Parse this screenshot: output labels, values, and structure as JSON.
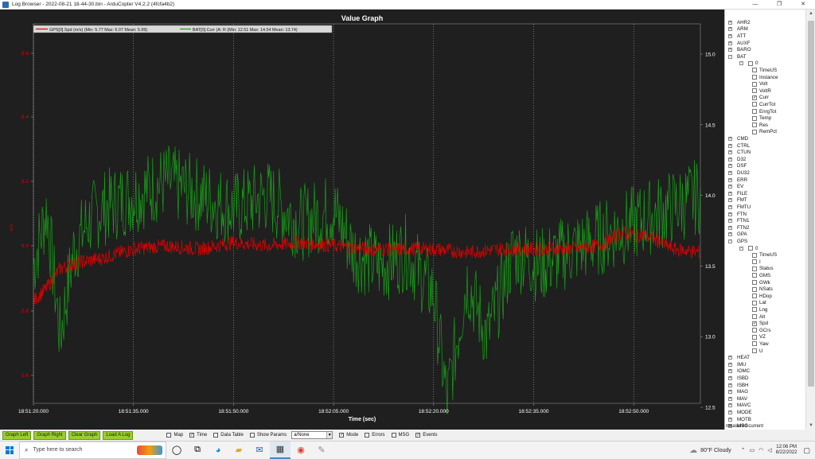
{
  "window": {
    "title": "Log Browser - 2022-08-21 18-44-30.bin - ArduCopter V4.2.2 (4fcfa4b2)",
    "controls": [
      "—",
      "❐",
      "✕"
    ]
  },
  "graph": {
    "title": "Value Graph",
    "xlabel": "Time (sec)",
    "legend": [
      {
        "label": "GPS[0].Spd (m/s)  (Min: 5.77 Max: 6.07 Mean: 5.99)",
        "color": "#e00000"
      },
      {
        "label": "BAT[0].Curr (A: R  (Min: 12.51 Max: 14.54 Mean: 13.74)",
        "color": "#16a016"
      }
    ],
    "left_ticks": [
      "6.8",
      "6.4",
      "6.2",
      "6.0",
      "5.8",
      "5.6"
    ],
    "left_unit": "m/s",
    "right_ticks": [
      "15.0",
      "14.5",
      "14.0",
      "13.5",
      "13.0",
      "12.5"
    ],
    "x_ticks": [
      "18:51:20.000",
      "18:51:35.000",
      "18:51:50.000",
      "18:52:05.000",
      "18:52:20.000",
      "18:52:35.000",
      "18:52:50.000"
    ]
  },
  "chart_data": {
    "type": "line",
    "title": "Value Graph",
    "xlabel": "Time (sec)",
    "ylabel_left": "m/s",
    "x_range": [
      "18:51:20",
      "18:53:00"
    ],
    "y_left_ticks": [
      6.8,
      6.4,
      6.2,
      6.0,
      5.8,
      5.6
    ],
    "y_right_range": [
      12.5,
      15.0
    ],
    "grid": true,
    "legend_position": "top-left",
    "series": [
      {
        "name": "GPS[0].Spd (m/s)",
        "color": "#e00000",
        "axis": "left",
        "x": [
          "18:51:20",
          "18:51:22",
          "18:51:24",
          "18:51:27",
          "18:51:30",
          "18:51:35",
          "18:51:40",
          "18:51:45",
          "18:51:50",
          "18:51:55",
          "18:52:00",
          "18:52:05",
          "18:52:10",
          "18:52:15",
          "18:52:20",
          "18:52:25",
          "18:52:30",
          "18:52:35",
          "18:52:40",
          "18:52:45",
          "18:52:48",
          "18:52:52",
          "18:52:56",
          "18:53:00"
        ],
        "values": [
          5.83,
          5.87,
          5.93,
          5.95,
          5.96,
          5.99,
          6.0,
          5.99,
          6.01,
          6.0,
          6.01,
          6.0,
          5.99,
          5.99,
          5.99,
          5.98,
          5.99,
          5.99,
          5.99,
          6.0,
          6.04,
          6.03,
          5.99,
          5.98
        ]
      },
      {
        "name": "BAT[0].Curr (A: R",
        "color": "#16a016",
        "axis": "right",
        "x": [
          "18:51:20",
          "18:51:22",
          "18:51:24",
          "18:51:26",
          "18:51:28",
          "18:51:30",
          "18:51:35",
          "18:51:40",
          "18:51:45",
          "18:51:50",
          "18:51:55",
          "18:52:00",
          "18:52:05",
          "18:52:08",
          "18:52:12",
          "18:52:16",
          "18:52:20",
          "18:52:22",
          "18:52:25",
          "18:52:28",
          "18:52:32",
          "18:52:36",
          "18:52:40",
          "18:52:45",
          "18:52:50",
          "18:52:55",
          "18:53:00"
        ],
        "values": [
          13.5,
          13.9,
          13.0,
          13.6,
          13.8,
          13.9,
          14.0,
          14.1,
          14.0,
          13.9,
          14.0,
          13.8,
          13.9,
          13.6,
          13.5,
          13.6,
          13.3,
          12.55,
          13.4,
          13.0,
          13.6,
          13.5,
          13.6,
          13.7,
          13.8,
          13.9,
          14.0
        ]
      }
    ]
  },
  "tree": {
    "items": [
      {
        "label": "AHR2",
        "level": 0,
        "exp": "+"
      },
      {
        "label": "ARM",
        "level": 0,
        "exp": "+"
      },
      {
        "label": "ATT",
        "level": 0,
        "exp": "+"
      },
      {
        "label": "AUXF",
        "level": 0,
        "exp": "+"
      },
      {
        "label": "BARO",
        "level": 0,
        "exp": "+"
      },
      {
        "label": "BAT",
        "level": 0,
        "exp": "−"
      },
      {
        "label": "0",
        "level": 1,
        "exp": "−",
        "cb": ""
      },
      {
        "label": "TimeUS",
        "level": 2,
        "cb": ""
      },
      {
        "label": "Instance",
        "level": 2,
        "cb": ""
      },
      {
        "label": "Volt",
        "level": 2,
        "cb": ""
      },
      {
        "label": "VoltR",
        "level": 2,
        "cb": ""
      },
      {
        "label": "Curr",
        "level": 2,
        "cb": "✓"
      },
      {
        "label": "CurrTot",
        "level": 2,
        "cb": ""
      },
      {
        "label": "EnrgTot",
        "level": 2,
        "cb": ""
      },
      {
        "label": "Temp",
        "level": 2,
        "cb": ""
      },
      {
        "label": "Res",
        "level": 2,
        "cb": ""
      },
      {
        "label": "RemPct",
        "level": 2,
        "cb": ""
      },
      {
        "label": "CMD",
        "level": 0,
        "exp": "+"
      },
      {
        "label": "CTRL",
        "level": 0,
        "exp": "+"
      },
      {
        "label": "CTUN",
        "level": 0,
        "exp": "+"
      },
      {
        "label": "D32",
        "level": 0,
        "exp": "+"
      },
      {
        "label": "DSF",
        "level": 0,
        "exp": "+"
      },
      {
        "label": "DU32",
        "level": 0,
        "exp": "+"
      },
      {
        "label": "ERR",
        "level": 0,
        "exp": "+"
      },
      {
        "label": "EV",
        "level": 0,
        "exp": "+"
      },
      {
        "label": "FILE",
        "level": 0,
        "exp": "+"
      },
      {
        "label": "FMT",
        "level": 0,
        "exp": "+"
      },
      {
        "label": "FMTU",
        "level": 0,
        "exp": "+"
      },
      {
        "label": "FTN",
        "level": 0,
        "exp": "+"
      },
      {
        "label": "FTN1",
        "level": 0,
        "exp": "+"
      },
      {
        "label": "FTN2",
        "level": 0,
        "exp": "+"
      },
      {
        "label": "GPA",
        "level": 0,
        "exp": "+"
      },
      {
        "label": "GPS",
        "level": 0,
        "exp": "−"
      },
      {
        "label": "0",
        "level": 1,
        "exp": "−",
        "cb": ""
      },
      {
        "label": "TimeUS",
        "level": 2,
        "cb": ""
      },
      {
        "label": "I",
        "level": 2,
        "cb": ""
      },
      {
        "label": "Status",
        "level": 2,
        "cb": ""
      },
      {
        "label": "GMS",
        "level": 2,
        "cb": ""
      },
      {
        "label": "GWk",
        "level": 2,
        "cb": ""
      },
      {
        "label": "NSats",
        "level": 2,
        "cb": ""
      },
      {
        "label": "HDop",
        "level": 2,
        "cb": ""
      },
      {
        "label": "Lat",
        "level": 2,
        "cb": ""
      },
      {
        "label": "Lng",
        "level": 2,
        "cb": ""
      },
      {
        "label": "Alt",
        "level": 2,
        "cb": ""
      },
      {
        "label": "Spd",
        "level": 2,
        "cb": "✓"
      },
      {
        "label": "GCrs",
        "level": 2,
        "cb": ""
      },
      {
        "label": "VZ",
        "level": 2,
        "cb": ""
      },
      {
        "label": "Yaw",
        "level": 2,
        "cb": ""
      },
      {
        "label": "U",
        "level": 2,
        "cb": ""
      },
      {
        "label": "HEAT",
        "level": 0,
        "exp": "+"
      },
      {
        "label": "IMU",
        "level": 0,
        "exp": "+"
      },
      {
        "label": "IOMC",
        "level": 0,
        "exp": "+"
      },
      {
        "label": "ISBD",
        "level": 0,
        "exp": "+"
      },
      {
        "label": "ISBH",
        "level": 0,
        "exp": "+"
      },
      {
        "label": "MAG",
        "level": 0,
        "exp": "+"
      },
      {
        "label": "MAV",
        "level": 0,
        "exp": "+"
      },
      {
        "label": "MAVC",
        "level": 0,
        "exp": "+"
      },
      {
        "label": "MODE",
        "level": 0,
        "exp": "+"
      },
      {
        "label": "MOTB",
        "level": 0,
        "exp": "+"
      },
      {
        "label": "MSG",
        "level": 0,
        "exp": "+"
      },
      {
        "label": "MULT",
        "level": 0,
        "exp": "+"
      }
    ],
    "status": "measured current"
  },
  "bottom": {
    "buttons": [
      "Graph Left",
      "Graph Right",
      "Clear Graph",
      "Load A Log"
    ],
    "options": [
      {
        "label": "Map",
        "checked": false
      },
      {
        "label": "Time",
        "checked": true
      },
      {
        "label": "Data Table",
        "checked": false
      },
      {
        "label": "Show Params",
        "checked": false
      }
    ],
    "select_value": "a/None",
    "options2": [
      {
        "label": "Mode",
        "checked": true
      },
      {
        "label": "Errors",
        "checked": false
      },
      {
        "label": "MSG",
        "checked": false
      },
      {
        "label": "Events",
        "checked": true
      }
    ]
  },
  "taskbar": {
    "search_placeholder": "Type here to search",
    "weather": "80°F  Cloudy",
    "time": "12:06 PM",
    "date": "8/22/2022"
  }
}
